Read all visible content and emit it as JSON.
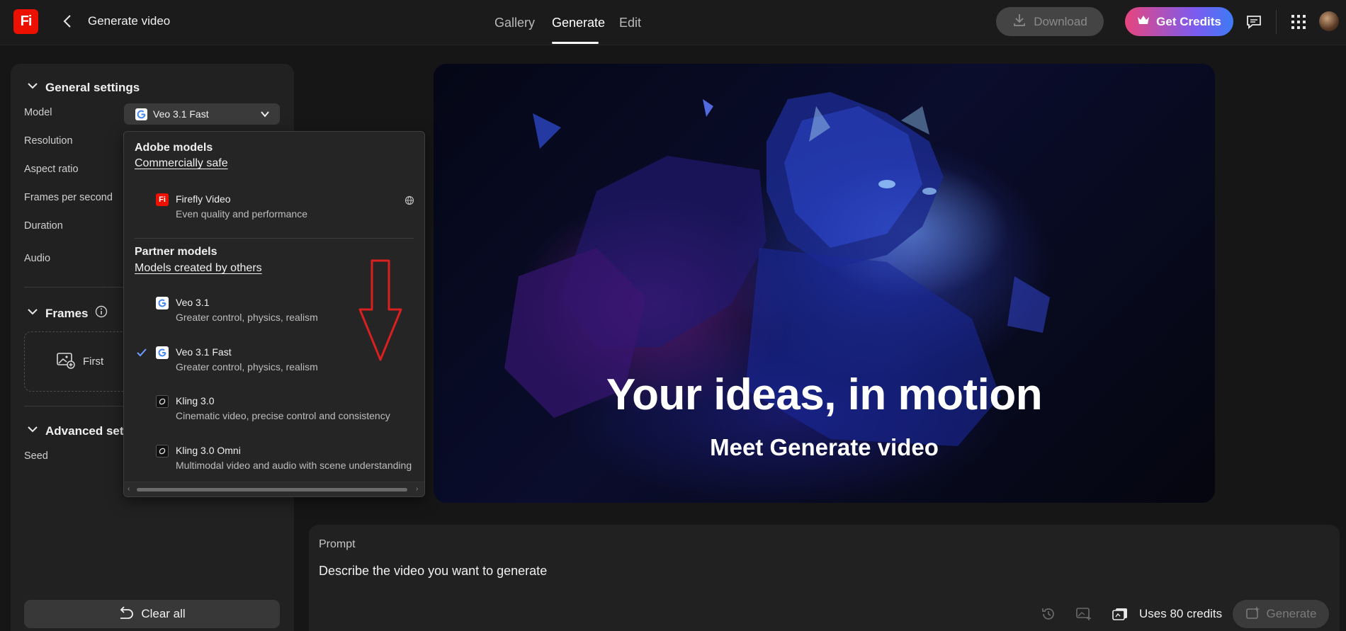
{
  "header": {
    "logo_text": "Fi",
    "title": "Generate video",
    "nav": [
      {
        "label": "Gallery",
        "active": false
      },
      {
        "label": "Generate",
        "active": true
      },
      {
        "label": "Edit",
        "active": false
      }
    ],
    "download_label": "Download",
    "get_credits_label": "Get Credits"
  },
  "settings": {
    "general_title": "General settings",
    "labels": {
      "model": "Model",
      "resolution": "Resolution",
      "aspect_ratio": "Aspect ratio",
      "fps": "Frames per second",
      "duration": "Duration",
      "audio": "Audio"
    },
    "model_value": "Veo 3.1 Fast",
    "frames_title": "Frames",
    "first_frame_label": "First",
    "advanced_title": "Advanced setti",
    "seed_label": "Seed",
    "clear_all_label": "Clear all"
  },
  "dropdown": {
    "adobe_group": "Adobe models",
    "adobe_sub": "Commercially safe",
    "adobe_items": [
      {
        "name": "Firefly Video",
        "desc": "Even quality and performance",
        "icon": "firefly-icon"
      }
    ],
    "partner_group": "Partner models",
    "partner_sub": "Models created by others",
    "partner_items": [
      {
        "name": "Veo 3.1",
        "desc": "Greater control, physics, realism",
        "icon": "google-icon",
        "selected": false
      },
      {
        "name": "Veo 3.1 Fast",
        "desc": "Greater control, physics, realism",
        "icon": "google-icon",
        "selected": true
      },
      {
        "name": "Kling 3.0",
        "desc": "Cinematic video, precise control and consistency",
        "icon": "kling-icon",
        "selected": false
      },
      {
        "name": "Kling 3.0 Omni",
        "desc": "Multimodal video and audio with scene understanding",
        "icon": "kling-icon",
        "selected": false
      }
    ]
  },
  "hero": {
    "title": "Your ideas, in motion",
    "subtitle": "Meet Generate video"
  },
  "prompt": {
    "label": "Prompt",
    "placeholder": "Describe the video you want to generate",
    "credits_text": "Uses 80 credits",
    "generate_label": "Generate"
  },
  "colors": {
    "accent": "#eb1000",
    "check": "#6e9bff",
    "annotation_arrow": "#d92020"
  }
}
